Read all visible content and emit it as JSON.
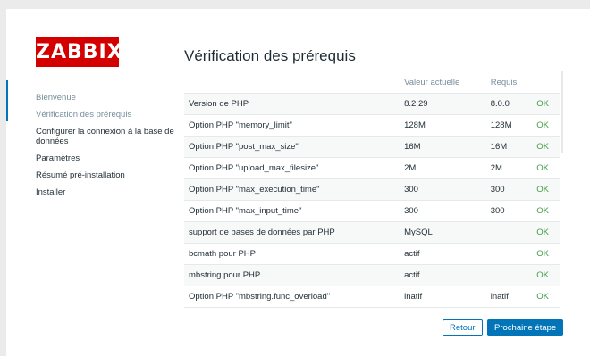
{
  "logo": "ZABBIX",
  "steps": [
    {
      "label": "Bienvenue",
      "state": "done"
    },
    {
      "label": "Vérification des prérequis",
      "state": "done"
    },
    {
      "label": "Configurer la connexion à la base de données",
      "state": "pending"
    },
    {
      "label": "Paramètres",
      "state": "pending"
    },
    {
      "label": "Résumé pré-installation",
      "state": "pending"
    },
    {
      "label": "Installer",
      "state": "pending"
    }
  ],
  "title": "Vérification des prérequis",
  "table": {
    "headers": [
      "",
      "Valeur actuelle",
      "Requis",
      ""
    ],
    "rows": [
      {
        "name": "Version de PHP",
        "current": "8.2.29",
        "required": "8.0.0",
        "status": "OK"
      },
      {
        "name": "Option PHP \"memory_limit\"",
        "current": "128M",
        "required": "128M",
        "status": "OK"
      },
      {
        "name": "Option PHP \"post_max_size\"",
        "current": "16M",
        "required": "16M",
        "status": "OK"
      },
      {
        "name": "Option PHP \"upload_max_filesize\"",
        "current": "2M",
        "required": "2M",
        "status": "OK"
      },
      {
        "name": "Option PHP \"max_execution_time\"",
        "current": "300",
        "required": "300",
        "status": "OK"
      },
      {
        "name": "Option PHP \"max_input_time\"",
        "current": "300",
        "required": "300",
        "status": "OK"
      },
      {
        "name": "support de bases de données par PHP",
        "current": "MySQL",
        "required": "",
        "status": "OK"
      },
      {
        "name": "bcmath pour PHP",
        "current": "actif",
        "required": "",
        "status": "OK"
      },
      {
        "name": "mbstring pour PHP",
        "current": "actif",
        "required": "",
        "status": "OK"
      },
      {
        "name": "Option PHP \"mbstring.func_overload\"",
        "current": "inatif",
        "required": "inatif",
        "status": "OK"
      }
    ]
  },
  "buttons": {
    "back": "Retour",
    "next": "Prochaine étape"
  },
  "colors": {
    "brand": "#d40000",
    "accent": "#0275b8",
    "ok": "#429e47"
  }
}
